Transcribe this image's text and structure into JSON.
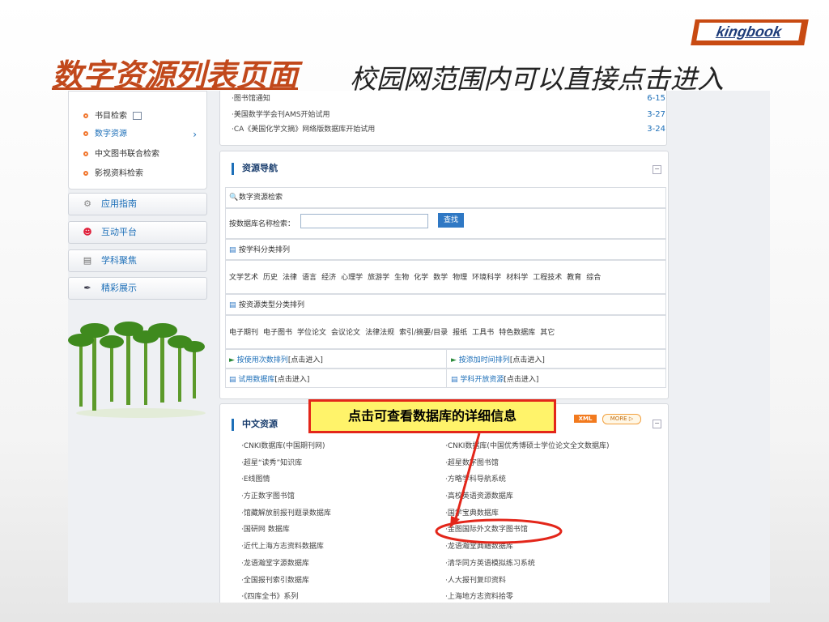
{
  "logo": "kingbook",
  "slide": {
    "title_main": "数字资源列表页面",
    "title_sub": "校园网范围内可以直接点击进入"
  },
  "sidebar": {
    "sub_items": [
      {
        "label": "书目检索",
        "icon": "book-icon"
      },
      {
        "label": "数字资源",
        "active": true
      },
      {
        "label": "中文图书联合检索"
      },
      {
        "label": "影视资料检索"
      }
    ],
    "menu": [
      {
        "label": "应用指南",
        "icon": "gear-icon"
      },
      {
        "label": "互动平台",
        "icon": "smile-icon"
      },
      {
        "label": "学科聚焦",
        "icon": "list-icon"
      },
      {
        "label": "精彩展示",
        "icon": "brush-icon"
      }
    ]
  },
  "news": [
    {
      "title": "·图书馆通知",
      "date": "6-15"
    },
    {
      "title": "·美国数学学会刊AMS开始试用",
      "date": "3-27"
    },
    {
      "title": "·CA《美国化学文摘》网络版数据库开始试用",
      "date": "3-24"
    }
  ],
  "nav_panel": {
    "title": "资源导航",
    "search_title": "数字资源检索",
    "search_label": "按数据库名称检索：",
    "search_button": "查找",
    "subject_title": "按学科分类排列",
    "subjects": [
      "文学艺术",
      "历史",
      "法律",
      "语言",
      "经济",
      "心理学",
      "旅游学",
      "生物",
      "化学",
      "数学",
      "物理",
      "环境科学",
      "材料学",
      "工程技术",
      "教育",
      "综合"
    ],
    "type_title": "按资源类型分类排列",
    "types": [
      "电子期刊",
      "电子图书",
      "学位论文",
      "会议论文",
      "法律法规",
      "索引/摘要/目录",
      "报纸",
      "工具书",
      "特色数据库",
      "其它"
    ],
    "links": [
      {
        "text": "按使用次数排列",
        "suffix": "[点击进入]"
      },
      {
        "text": "按添加时间排列",
        "suffix": "[点击进入]"
      },
      {
        "text": "试用数据库",
        "suffix": "[点击进入]"
      },
      {
        "text": "学科开放资源",
        "suffix": "[点击进入]"
      }
    ]
  },
  "chinese_panel": {
    "title": "中文资源",
    "xml": "XML",
    "more": "MORE",
    "left": [
      "·CNKI数据库(中国期刊网)",
      "·超星“读秀”知识库",
      "·E线图情",
      "·方正数字图书馆",
      "·馆藏解放前报刊题录数据库",
      "·国研网 数据库",
      "·近代上海方志资料数据库",
      "·龙语瀚堂字源数据库",
      "·全国报刊索引数据库",
      "·《四库全书》系列"
    ],
    "right": [
      "·CNKI数据库(中国优秀博硕士学位论文全文数据库)",
      "·超星数字图书馆",
      "·方略学科导航系统",
      "·高校英语资源数据库",
      "·国学宝典数据库",
      "·金图国际外文数字图书馆",
      "·龙语瀚堂典籍数据库",
      "·清华同方英语模拟练习系统",
      "·人大报刊复印资料",
      "·上海地方志资料拾零"
    ]
  },
  "callout": "点击可查看数据库的详细信息",
  "colors": {
    "accent": "#c1481b",
    "link": "#1d6fb8",
    "callout_border": "#e3261a",
    "callout_fill": "#fff36a"
  }
}
